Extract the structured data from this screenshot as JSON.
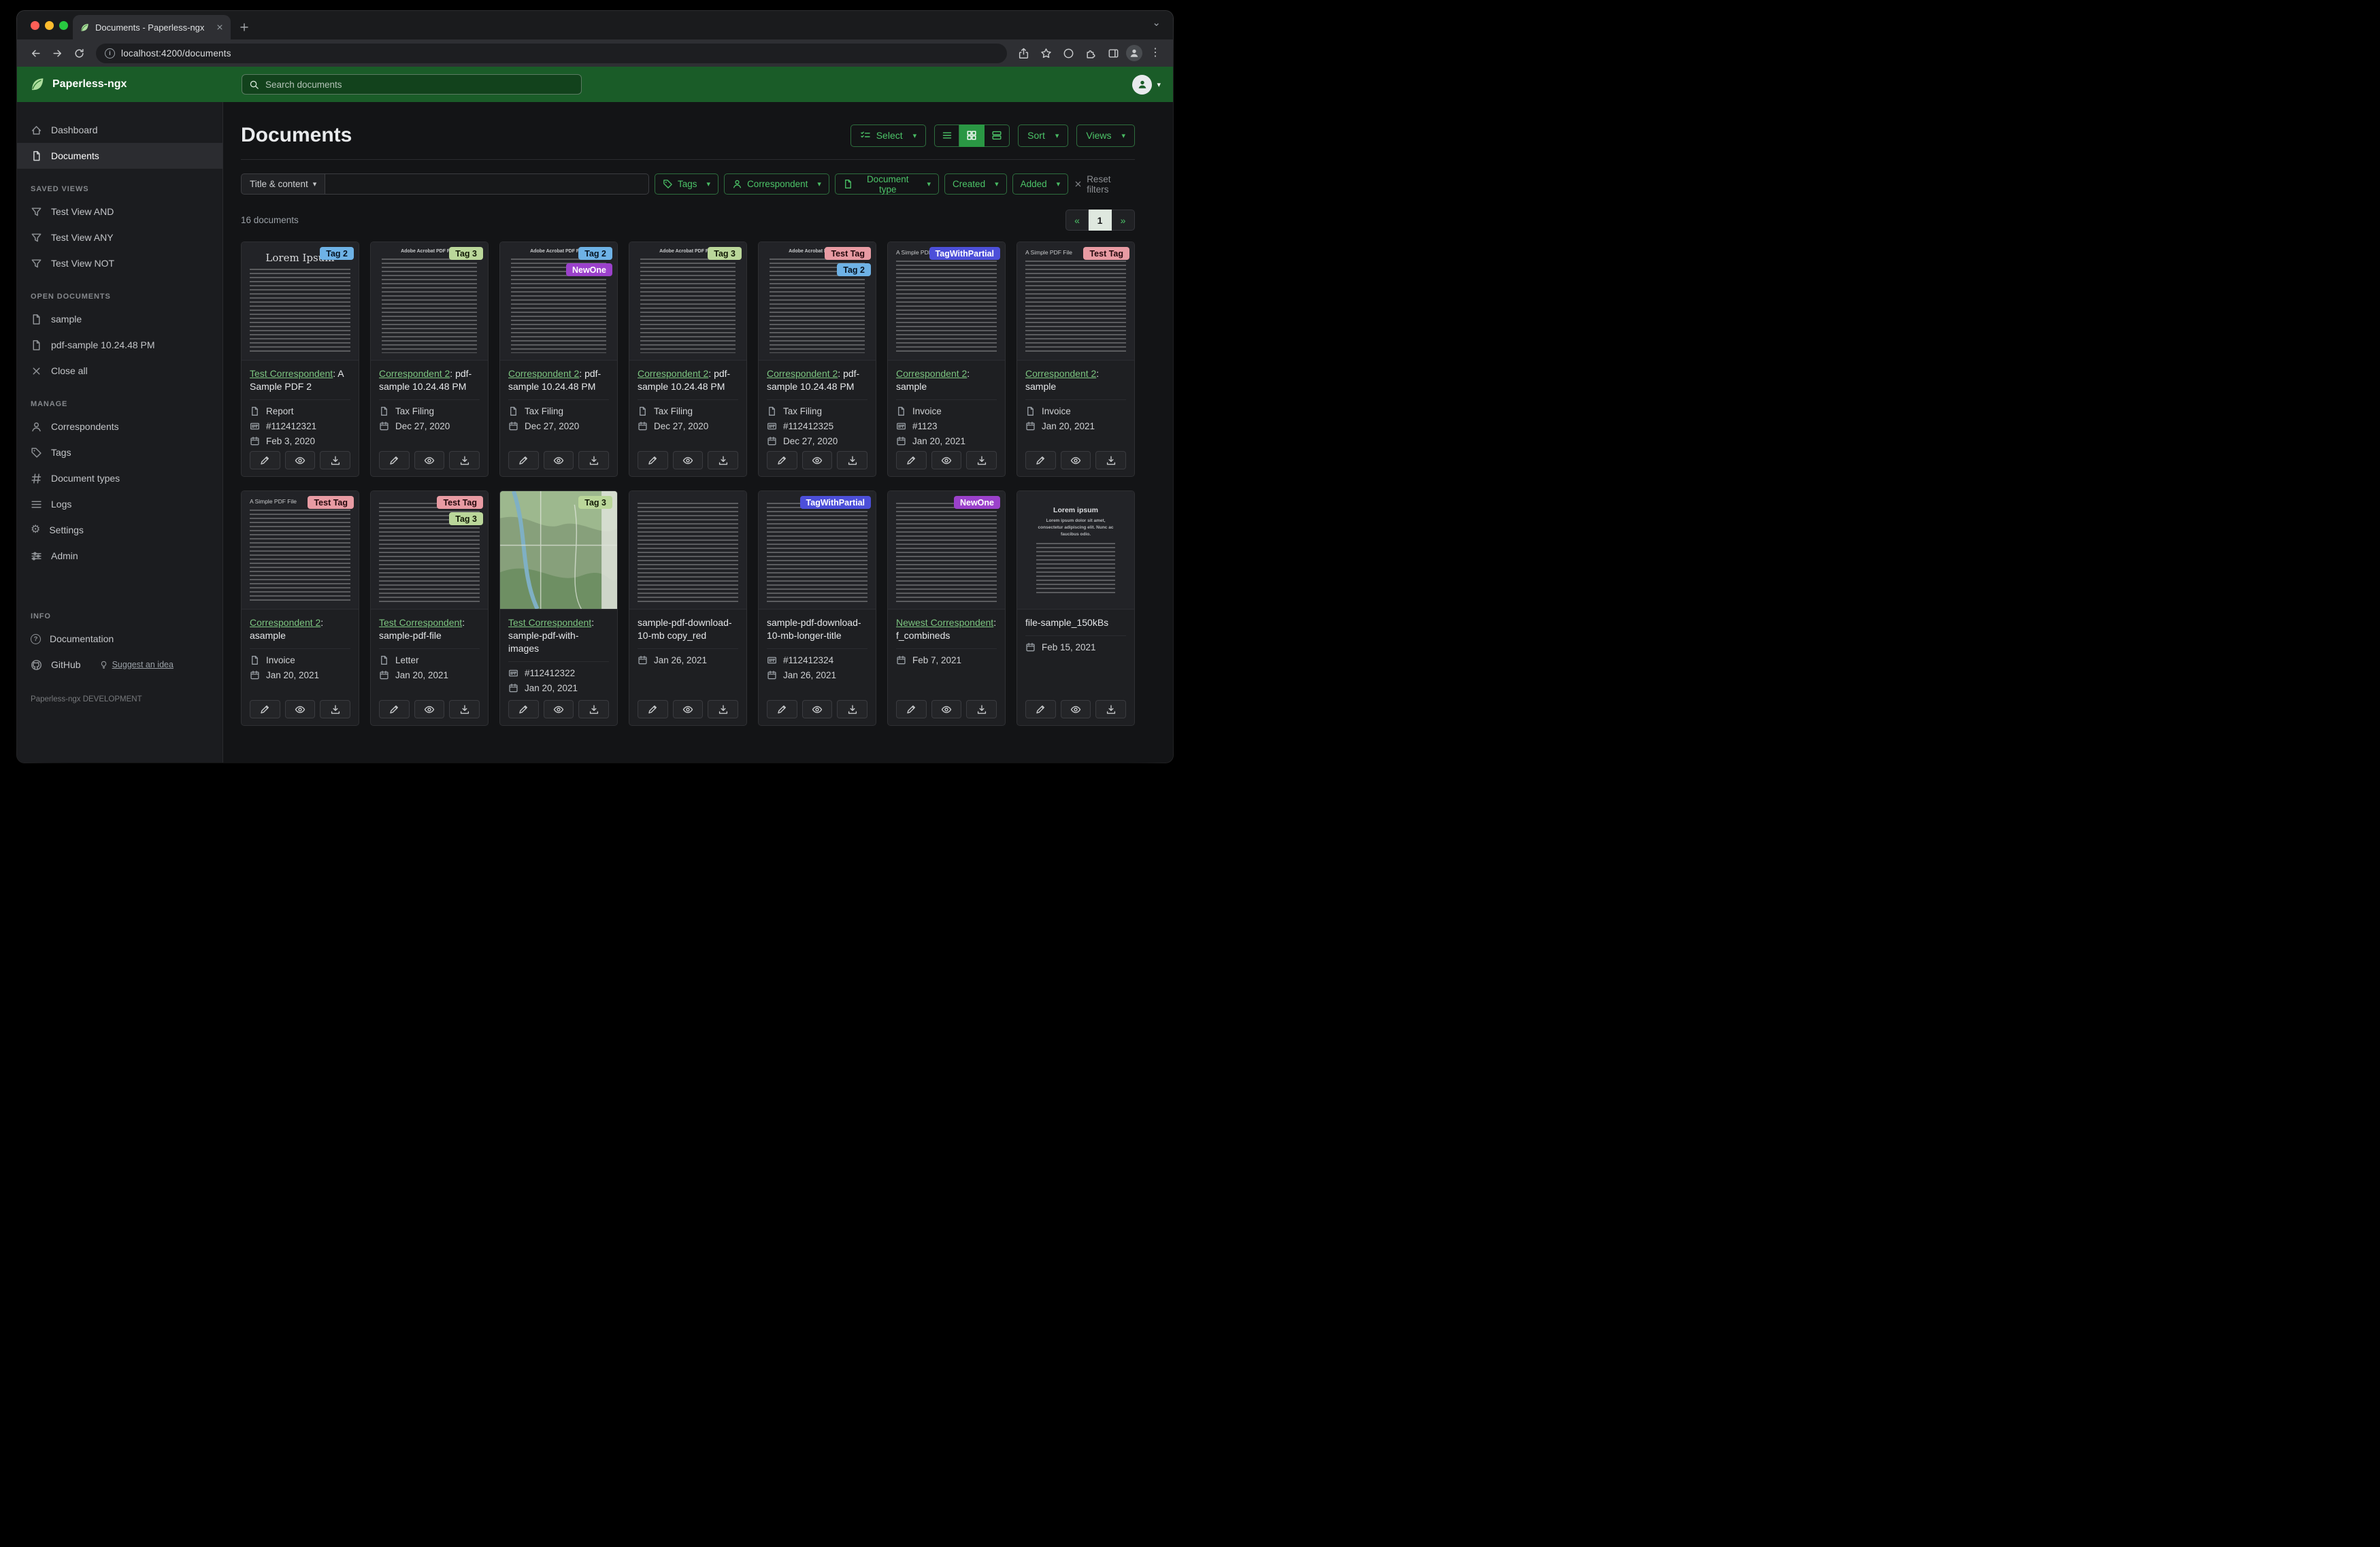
{
  "browser": {
    "tab_title": "Documents - Paperless-ngx",
    "url": "localhost:4200/documents"
  },
  "header": {
    "app_name": "Paperless-ngx",
    "search_placeholder": "Search documents"
  },
  "sidebar": {
    "items_top": [
      {
        "icon": "dashboard-icon",
        "label": "Dashboard",
        "active": false
      },
      {
        "icon": "documents-icon",
        "label": "Documents",
        "active": true
      }
    ],
    "sections": [
      {
        "title": "SAVED VIEWS",
        "items": [
          {
            "icon": "filter-icon",
            "label": "Test View AND"
          },
          {
            "icon": "filter-icon",
            "label": "Test View ANY"
          },
          {
            "icon": "filter-icon",
            "label": "Test View NOT"
          }
        ]
      },
      {
        "title": "OPEN DOCUMENTS",
        "items": [
          {
            "icon": "file-icon",
            "label": "sample"
          },
          {
            "icon": "file-icon",
            "label": "pdf-sample 10.24.48 PM"
          },
          {
            "icon": "close-icon",
            "label": "Close all"
          }
        ]
      },
      {
        "title": "MANAGE",
        "items": [
          {
            "icon": "person-icon",
            "label": "Correspondents"
          },
          {
            "icon": "tag-icon",
            "label": "Tags"
          },
          {
            "icon": "hash-icon",
            "label": "Document types"
          },
          {
            "icon": "list-icon",
            "label": "Logs"
          },
          {
            "icon": "gear-icon",
            "label": "Settings"
          },
          {
            "icon": "sliders-icon",
            "label": "Admin"
          }
        ]
      },
      {
        "title": "INFO",
        "items": [
          {
            "icon": "question-icon",
            "label": "Documentation"
          },
          {
            "icon": "github-icon",
            "label": "GitHub",
            "extra": {
              "icon": "bulb-icon",
              "label": "Suggest an idea"
            }
          }
        ]
      }
    ],
    "footer": "Paperless-ngx DEVELOPMENT"
  },
  "main": {
    "title": "Documents",
    "toolbar": {
      "select_label": "Select",
      "sort_label": "Sort",
      "views_label": "Views"
    },
    "filters": {
      "field_selector": "Title & content",
      "buttons": [
        {
          "icon": "tag-icon",
          "label": "Tags"
        },
        {
          "icon": "person-icon",
          "label": "Correspondent"
        },
        {
          "icon": "file-icon",
          "label": "Document type"
        },
        {
          "icon": null,
          "label": "Created"
        },
        {
          "icon": null,
          "label": "Added"
        }
      ],
      "reset_label": "Reset filters"
    },
    "count_text": "16 documents",
    "pagination": {
      "prev": "«",
      "current": "1",
      "next": "»"
    }
  },
  "tag_palette": {
    "Tag 2": {
      "bg": "#6eb2e6",
      "fg": "#061422"
    },
    "Tag 3": {
      "bg": "#bad79a",
      "fg": "#121a06"
    },
    "NewOne": {
      "bg": "#9b41cb",
      "fg": "#ffffff"
    },
    "Test Tag": {
      "bg": "#e89ba3",
      "fg": "#23070b"
    },
    "TagWithPartial": {
      "bg": "#4c4fd9",
      "fg": "#ffffff"
    }
  },
  "card_actions": [
    {
      "name": "edit",
      "icon": "pencil-icon"
    },
    {
      "name": "preview",
      "icon": "eye-icon"
    },
    {
      "name": "download",
      "icon": "download-icon"
    }
  ],
  "documents": [
    {
      "tags": [
        "Tag 2"
      ],
      "thumb": {
        "variant": "lorem-serif",
        "heading": "Lorem Ipsum"
      },
      "correspondent": "Test Correspondent",
      "title": "A Sample PDF 2",
      "meta": [
        {
          "kind": "type",
          "icon": "file-icon",
          "text": "Report"
        },
        {
          "kind": "asn",
          "icon": "card-icon",
          "text": "#112412321"
        },
        {
          "kind": "date",
          "icon": "calendar-icon",
          "text": "Feb 3, 2020"
        }
      ]
    },
    {
      "tags": [
        "Tag 3"
      ],
      "thumb": {
        "variant": "acrobat",
        "heading": "Adobe Acrobat PDF Files"
      },
      "correspondent": "Correspondent 2",
      "title": "pdf-sample 10.24.48 PM",
      "meta": [
        {
          "kind": "type",
          "icon": "file-icon",
          "text": "Tax Filing"
        },
        {
          "kind": "date",
          "icon": "calendar-icon",
          "text": "Dec 27, 2020"
        }
      ]
    },
    {
      "tags": [
        "Tag 2",
        "NewOne"
      ],
      "thumb": {
        "variant": "acrobat",
        "heading": "Adobe Acrobat PDF Files"
      },
      "correspondent": "Correspondent 2",
      "title": "pdf-sample 10.24.48 PM",
      "meta": [
        {
          "kind": "type",
          "icon": "file-icon",
          "text": "Tax Filing"
        },
        {
          "kind": "date",
          "icon": "calendar-icon",
          "text": "Dec 27, 2020"
        }
      ]
    },
    {
      "tags": [
        "Tag 3"
      ],
      "thumb": {
        "variant": "acrobat",
        "heading": "Adobe Acrobat PDF Files"
      },
      "correspondent": "Correspondent 2",
      "title": "pdf-sample 10.24.48 PM",
      "meta": [
        {
          "kind": "type",
          "icon": "file-icon",
          "text": "Tax Filing"
        },
        {
          "kind": "date",
          "icon": "calendar-icon",
          "text": "Dec 27, 2020"
        }
      ]
    },
    {
      "tags": [
        "Test Tag",
        "Tag 2"
      ],
      "thumb": {
        "variant": "acrobat",
        "heading": "Adobe Acrobat PDF Files"
      },
      "correspondent": "Correspondent 2",
      "title": "pdf-sample 10.24.48 PM",
      "meta": [
        {
          "kind": "type",
          "icon": "file-icon",
          "text": "Tax Filing"
        },
        {
          "kind": "asn",
          "icon": "card-icon",
          "text": "#112412325"
        },
        {
          "kind": "date",
          "icon": "calendar-icon",
          "text": "Dec 27, 2020"
        }
      ]
    },
    {
      "tags": [
        "TagWithPartial"
      ],
      "thumb": {
        "variant": "simple",
        "heading": "A Simple PDF File"
      },
      "correspondent": "Correspondent 2",
      "title": "sample",
      "meta": [
        {
          "kind": "type",
          "icon": "file-icon",
          "text": "Invoice"
        },
        {
          "kind": "asn",
          "icon": "card-icon",
          "text": "#1123"
        },
        {
          "kind": "date",
          "icon": "calendar-icon",
          "text": "Jan 20, 2021"
        }
      ]
    },
    {
      "tags": [
        "Test Tag"
      ],
      "thumb": {
        "variant": "simple",
        "heading": "A Simple PDF File"
      },
      "correspondent": "Correspondent 2",
      "title": "sample",
      "meta": [
        {
          "kind": "type",
          "icon": "file-icon",
          "text": "Invoice"
        },
        {
          "kind": "date",
          "icon": "calendar-icon",
          "text": "Jan 20, 2021"
        }
      ]
    },
    {
      "tags": [
        "Test Tag"
      ],
      "thumb": {
        "variant": "simple",
        "heading": "A Simple PDF File"
      },
      "correspondent": "Correspondent 2",
      "title": "asample",
      "meta": [
        {
          "kind": "type",
          "icon": "file-icon",
          "text": "Invoice"
        },
        {
          "kind": "date",
          "icon": "calendar-icon",
          "text": "Jan 20, 2021"
        }
      ]
    },
    {
      "tags": [
        "Test Tag",
        "Tag 3"
      ],
      "thumb": {
        "variant": "dense",
        "heading": null
      },
      "correspondent": "Test Correspondent",
      "title": "sample-pdf-file",
      "meta": [
        {
          "kind": "type",
          "icon": "file-icon",
          "text": "Letter"
        },
        {
          "kind": "date",
          "icon": "calendar-icon",
          "text": "Jan 20, 2021"
        }
      ]
    },
    {
      "tags": [
        "Tag 3"
      ],
      "thumb": {
        "variant": "map",
        "heading": null
      },
      "correspondent": "Test Correspondent",
      "title": "sample-pdf-with-images",
      "meta": [
        {
          "kind": "asn",
          "icon": "card-icon",
          "text": "#112412322"
        },
        {
          "kind": "date",
          "icon": "calendar-icon",
          "text": "Jan 20, 2021"
        }
      ]
    },
    {
      "tags": [],
      "thumb": {
        "variant": "dense",
        "heading": null
      },
      "correspondent": null,
      "title": "sample-pdf-download-10-mb copy_red",
      "meta": [
        {
          "kind": "date",
          "icon": "calendar-icon",
          "text": "Jan 26, 2021"
        }
      ]
    },
    {
      "tags": [
        "TagWithPartial"
      ],
      "thumb": {
        "variant": "dense",
        "heading": null
      },
      "correspondent": null,
      "title": "sample-pdf-download-10-mb-longer-title",
      "meta": [
        {
          "kind": "asn",
          "icon": "card-icon",
          "text": "#112412324"
        },
        {
          "kind": "date",
          "icon": "calendar-icon",
          "text": "Jan 26, 2021"
        }
      ]
    },
    {
      "tags": [
        "NewOne"
      ],
      "thumb": {
        "variant": "dense",
        "heading": null
      },
      "correspondent": "Newest Correspondent",
      "title": "f_combineds",
      "meta": [
        {
          "kind": "date",
          "icon": "calendar-icon",
          "text": "Feb 7, 2021"
        }
      ]
    },
    {
      "tags": [],
      "thumb": {
        "variant": "lorem-center",
        "heading": "Lorem ipsum",
        "subheading": "Lorem ipsum dolor sit amet, consectetur adipiscing elit. Nunc ac faucibus odio."
      },
      "correspondent": null,
      "title": "file-sample_150kBs",
      "meta": [
        {
          "kind": "date",
          "icon": "calendar-icon",
          "text": "Feb 15, 2021"
        }
      ]
    }
  ]
}
